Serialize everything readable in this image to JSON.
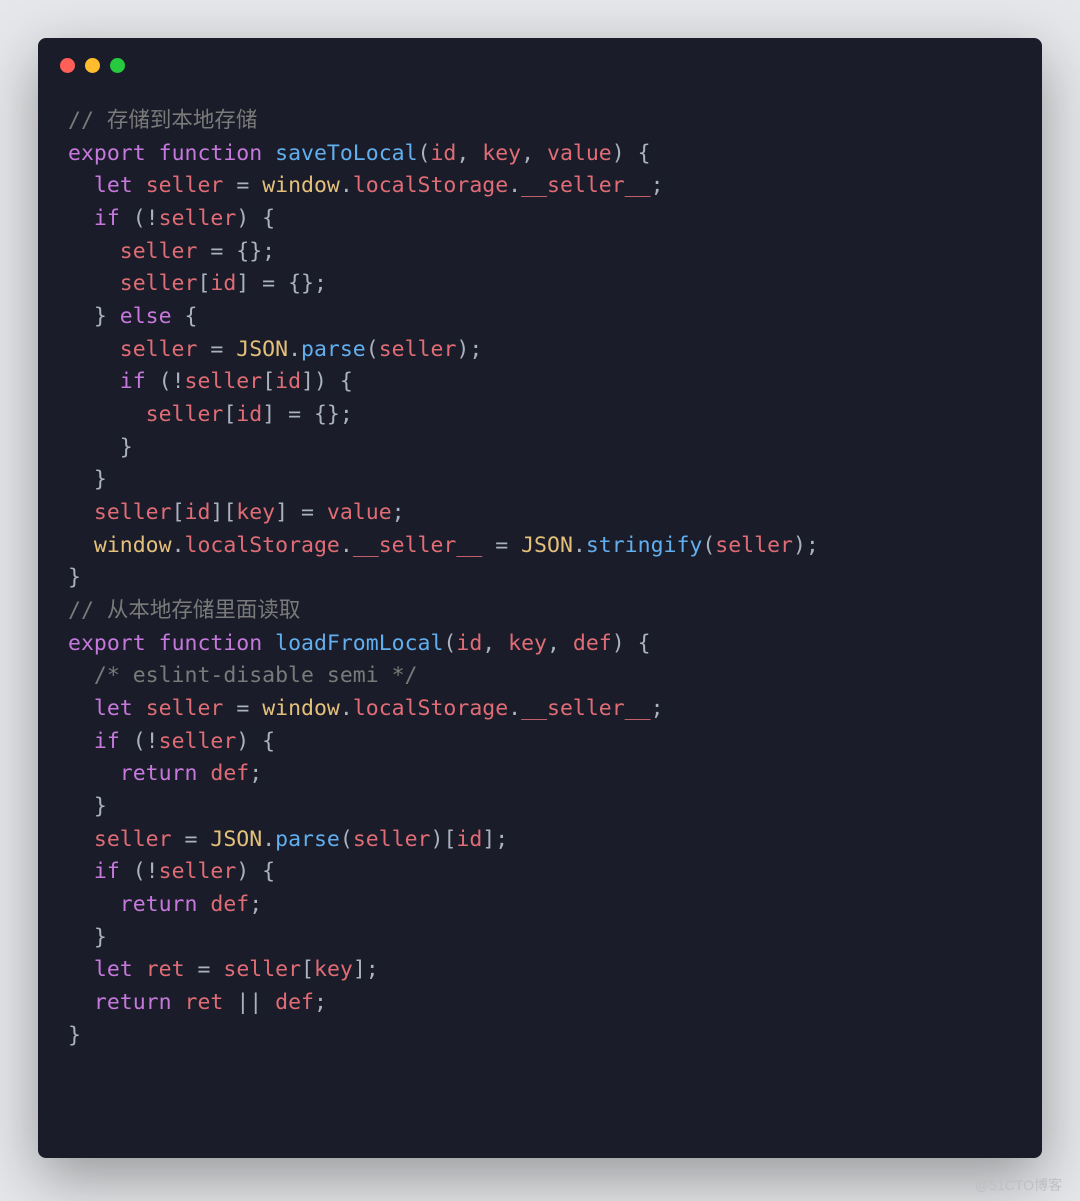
{
  "window": {
    "buttons": [
      "close",
      "minimize",
      "maximize"
    ]
  },
  "code": {
    "line1_c": "// 存储到本地存储",
    "line2_export": "export",
    "line2_function": "function",
    "line2_fn": "saveToLocal",
    "line2_p1": "id",
    "line2_p2": "key",
    "line2_p3": "value",
    "line3_let": "let",
    "line3_seller": "seller",
    "line3_window": "window",
    "line3_ls": "localStorage",
    "line3_s": "__seller__",
    "line4_if": "if",
    "line4_seller": "seller",
    "line5_seller": "seller",
    "line6_seller": "seller",
    "line6_id": "id",
    "line7_else": "else",
    "line8_seller": "seller",
    "line8_json": "JSON",
    "line8_parse": "parse",
    "line8_arg": "seller",
    "line9_if": "if",
    "line9_seller": "seller",
    "line9_id": "id",
    "line10_seller": "seller",
    "line10_id": "id",
    "line13_seller": "seller",
    "line13_id": "id",
    "line13_key": "key",
    "line13_value": "value",
    "line14_window": "window",
    "line14_ls": "localStorage",
    "line14_s": "__seller__",
    "line14_json": "JSON",
    "line14_str": "stringify",
    "line14_arg": "seller",
    "line16_c": "// 从本地存储里面读取",
    "line17_export": "export",
    "line17_function": "function",
    "line17_fn": "loadFromLocal",
    "line17_p1": "id",
    "line17_p2": "key",
    "line17_p3": "def",
    "line18_c": "/* eslint-disable semi */",
    "line19_let": "let",
    "line19_seller": "seller",
    "line19_window": "window",
    "line19_ls": "localStorage",
    "line19_s": "__seller__",
    "line20_if": "if",
    "line20_seller": "seller",
    "line21_return": "return",
    "line21_def": "def",
    "line23_seller": "seller",
    "line23_json": "JSON",
    "line23_parse": "parse",
    "line23_arg": "seller",
    "line23_id": "id",
    "line24_if": "if",
    "line24_seller": "seller",
    "line25_return": "return",
    "line25_def": "def",
    "line27_let": "let",
    "line27_ret": "ret",
    "line27_seller": "seller",
    "line27_key": "key",
    "line28_return": "return",
    "line28_ret": "ret",
    "line28_def": "def"
  },
  "watermark": "@51CTO博客"
}
